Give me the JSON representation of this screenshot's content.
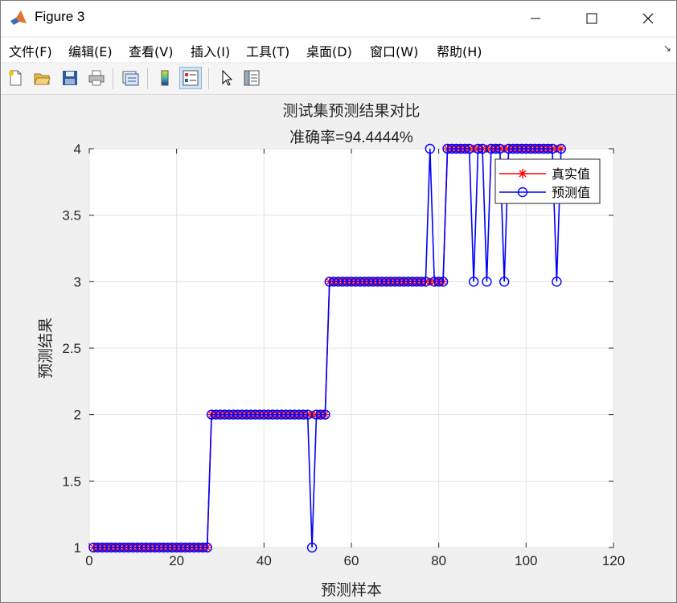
{
  "window": {
    "title": "Figure 3"
  },
  "menu": [
    {
      "label": "文件(F)"
    },
    {
      "label": "编辑(E)"
    },
    {
      "label": "查看(V)"
    },
    {
      "label": "插入(I)"
    },
    {
      "label": "工具(T)"
    },
    {
      "label": "桌面(D)"
    },
    {
      "label": "窗口(W)"
    },
    {
      "label": "帮助(H)"
    }
  ],
  "toolbar_icons": [
    "new-file-icon",
    "open-folder-icon",
    "save-icon",
    "print-icon",
    "link-plot-icon",
    "colorbar-icon",
    "legend-icon",
    "pointer-icon",
    "property-inspector-icon"
  ],
  "colors": {
    "true_series": "#ff0000",
    "pred_series": "#0000ff"
  },
  "chart_data": {
    "type": "line",
    "title": "测试集预测结果对比",
    "subtitle": "准确率=94.4444%",
    "xlabel": "预测样本",
    "ylabel": "预测结果",
    "xlim": [
      0,
      120
    ],
    "ylim": [
      1,
      4
    ],
    "xticks": [
      "0",
      "20",
      "40",
      "60",
      "80",
      "100",
      "120"
    ],
    "yticks": [
      "1",
      "1.5",
      "2",
      "2.5",
      "3",
      "3.5",
      "4"
    ],
    "grid": true,
    "legend_position": "top-right",
    "series": [
      {
        "name": "真实值",
        "marker": "*",
        "color": "#ff0000",
        "values": [
          1,
          1,
          1,
          1,
          1,
          1,
          1,
          1,
          1,
          1,
          1,
          1,
          1,
          1,
          1,
          1,
          1,
          1,
          1,
          1,
          1,
          1,
          1,
          1,
          1,
          1,
          1,
          2,
          2,
          2,
          2,
          2,
          2,
          2,
          2,
          2,
          2,
          2,
          2,
          2,
          2,
          2,
          2,
          2,
          2,
          2,
          2,
          2,
          2,
          2,
          2,
          2,
          2,
          2,
          3,
          3,
          3,
          3,
          3,
          3,
          3,
          3,
          3,
          3,
          3,
          3,
          3,
          3,
          3,
          3,
          3,
          3,
          3,
          3,
          3,
          3,
          3,
          3,
          3,
          3,
          3,
          4,
          4,
          4,
          4,
          4,
          4,
          4,
          4,
          4,
          4,
          4,
          4,
          4,
          4,
          4,
          4,
          4,
          4,
          4,
          4,
          4,
          4,
          4,
          4,
          4,
          4,
          4
        ]
      },
      {
        "name": "预测值",
        "marker": "o",
        "color": "#0000ff",
        "values": [
          1,
          1,
          1,
          1,
          1,
          1,
          1,
          1,
          1,
          1,
          1,
          1,
          1,
          1,
          1,
          1,
          1,
          1,
          1,
          1,
          1,
          1,
          1,
          1,
          1,
          1,
          1,
          2,
          2,
          2,
          2,
          2,
          2,
          2,
          2,
          2,
          2,
          2,
          2,
          2,
          2,
          2,
          2,
          2,
          2,
          2,
          2,
          2,
          2,
          2,
          1,
          2,
          2,
          2,
          3,
          3,
          3,
          3,
          3,
          3,
          3,
          3,
          3,
          3,
          3,
          3,
          3,
          3,
          3,
          3,
          3,
          3,
          3,
          3,
          3,
          3,
          3,
          4,
          3,
          3,
          3,
          4,
          4,
          4,
          4,
          4,
          4,
          3,
          4,
          4,
          3,
          4,
          4,
          4,
          3,
          4,
          4,
          4,
          4,
          4,
          4,
          4,
          4,
          4,
          4,
          4,
          3,
          4
        ]
      }
    ]
  }
}
